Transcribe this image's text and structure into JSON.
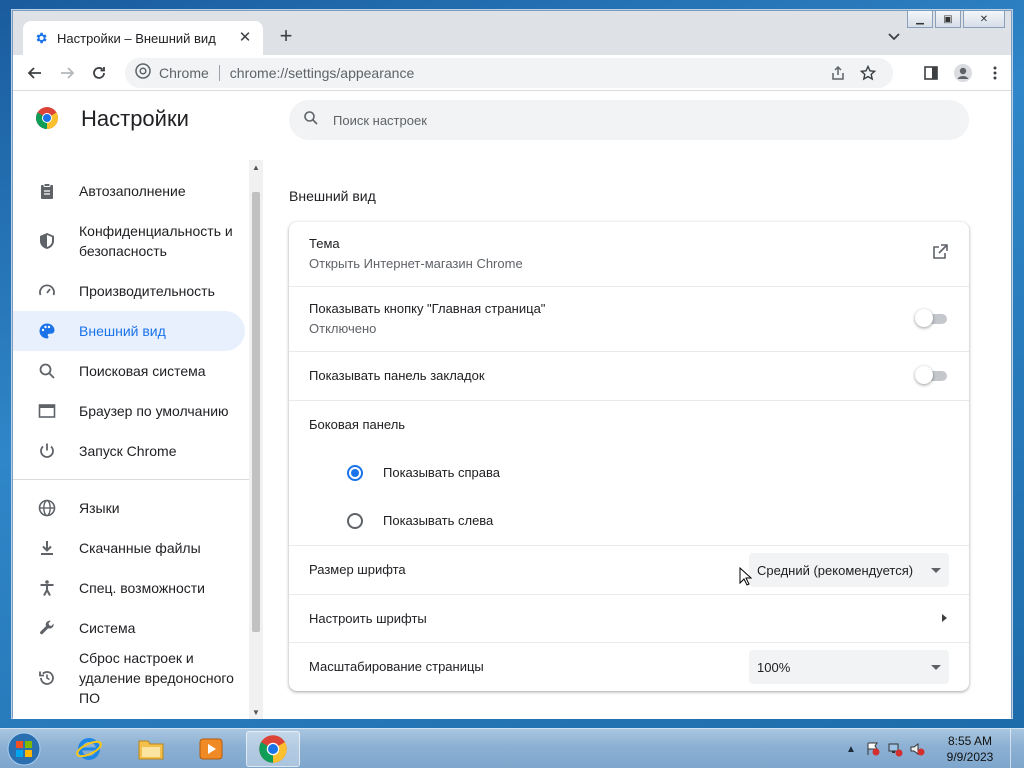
{
  "browser": {
    "tab_title": "Настройки – Внешний вид",
    "site_label": "Chrome",
    "url": "chrome://settings/appearance"
  },
  "settings": {
    "app_title": "Настройки",
    "search_placeholder": "Поиск настроек",
    "nav": [
      {
        "label": "Автозаполнение",
        "icon": "clipboard-icon"
      },
      {
        "label": "Конфиденциальность и безопасность",
        "icon": "shield-icon"
      },
      {
        "label": "Производительность",
        "icon": "speedometer-icon"
      },
      {
        "label": "Внешний вид",
        "icon": "palette-icon",
        "active": true
      },
      {
        "label": "Поисковая система",
        "icon": "search-icon"
      },
      {
        "label": "Браузер по умолчанию",
        "icon": "browser-icon"
      },
      {
        "label": "Запуск Chrome",
        "icon": "power-icon"
      },
      {
        "label": "Языки",
        "icon": "globe-icon"
      },
      {
        "label": "Скачанные файлы",
        "icon": "download-icon"
      },
      {
        "label": "Спец. возможности",
        "icon": "accessibility-icon"
      },
      {
        "label": "Система",
        "icon": "wrench-icon"
      },
      {
        "label": "Сброс настроек и удаление вредоносного ПО",
        "icon": "reset-icon"
      }
    ],
    "section_title": "Внешний вид",
    "theme": {
      "title": "Тема",
      "subtitle": "Открыть Интернет-магазин Chrome"
    },
    "home_button": {
      "title": "Показывать кнопку \"Главная страница\"",
      "subtitle": "Отключено",
      "enabled": false
    },
    "bookmarks_bar": {
      "title": "Показывать панель закладок",
      "enabled": false
    },
    "side_panel": {
      "title": "Боковая панель",
      "options": [
        {
          "label": "Показывать справа",
          "selected": true
        },
        {
          "label": "Показывать слева",
          "selected": false
        }
      ]
    },
    "font_size": {
      "title": "Размер шрифта",
      "value": "Средний (рекомендуется)"
    },
    "customize_fonts": {
      "title": "Настроить шрифты"
    },
    "page_zoom": {
      "title": "Масштабирование страницы",
      "value": "100%"
    }
  },
  "taskbar": {
    "time": "8:55 AM",
    "date": "9/9/2023"
  }
}
